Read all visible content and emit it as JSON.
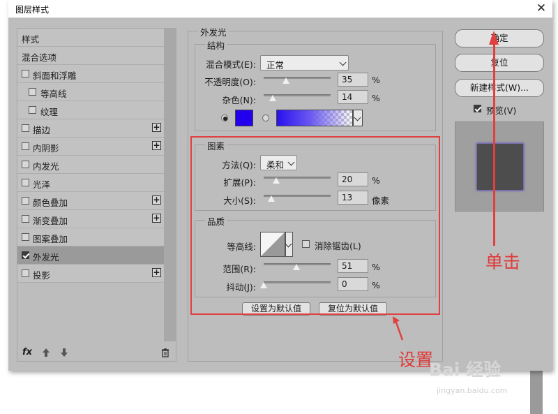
{
  "dialog": {
    "title": "图层样式",
    "close_glyph": "✕"
  },
  "styles_list": {
    "items": [
      {
        "label": "样式",
        "checkbox": false,
        "checked": false,
        "plus": false
      },
      {
        "label": "混合选项",
        "checkbox": false,
        "checked": false,
        "plus": false
      },
      {
        "label": "斜面和浮雕",
        "checkbox": true,
        "checked": false,
        "plus": false
      },
      {
        "label": "等高线",
        "checkbox": true,
        "checked": false,
        "plus": false,
        "indent": true
      },
      {
        "label": "纹理",
        "checkbox": true,
        "checked": false,
        "plus": false,
        "indent": true
      },
      {
        "label": "描边",
        "checkbox": true,
        "checked": false,
        "plus": true
      },
      {
        "label": "内阴影",
        "checkbox": true,
        "checked": false,
        "plus": true
      },
      {
        "label": "内发光",
        "checkbox": true,
        "checked": false,
        "plus": false
      },
      {
        "label": "光泽",
        "checkbox": true,
        "checked": false,
        "plus": false
      },
      {
        "label": "颜色叠加",
        "checkbox": true,
        "checked": false,
        "plus": true
      },
      {
        "label": "渐变叠加",
        "checkbox": true,
        "checked": false,
        "plus": true
      },
      {
        "label": "图案叠加",
        "checkbox": true,
        "checked": false,
        "plus": false
      },
      {
        "label": "外发光",
        "checkbox": true,
        "checked": true,
        "plus": false,
        "selected": true
      },
      {
        "label": "投影",
        "checkbox": true,
        "checked": false,
        "plus": true
      }
    ],
    "footer": {
      "fx": "fx",
      "trash_icon": "trash-icon"
    }
  },
  "outer_glow": {
    "section_title": "外发光",
    "structure": {
      "title": "结构",
      "blend_mode_label": "混合模式(E):",
      "blend_mode_value": "正常",
      "opacity_label": "不透明度(O):",
      "opacity_value": "35",
      "opacity_unit": "%",
      "noise_label": "杂色(N):",
      "noise_value": "14",
      "noise_unit": "%",
      "color": "#2200ee"
    },
    "elements": {
      "title": "图素",
      "technique_label": "方法(Q):",
      "technique_value": "柔和",
      "spread_label": "扩展(P):",
      "spread_value": "20",
      "spread_unit": "%",
      "size_label": "大小(S):",
      "size_value": "13",
      "size_unit": "像素"
    },
    "quality": {
      "title": "品质",
      "contour_label": "等高线:",
      "antialias_label": "消除锯齿(L)",
      "antialias_checked": false,
      "range_label": "范围(R):",
      "range_value": "51",
      "range_unit": "%",
      "jitter_label": "抖动(J):",
      "jitter_value": "0",
      "jitter_unit": "%"
    },
    "make_default": "设置为默认值",
    "reset_default": "复位为默认值"
  },
  "buttons": {
    "ok": "确定",
    "reset": "复位",
    "new_style": "新建样式(W)...",
    "preview_label": "预览(V)",
    "preview_checked": true
  },
  "annotations": {
    "click": "单击",
    "settings": "设置",
    "highlight_color": "#e04040"
  },
  "watermark": {
    "brand": "Bai 经验",
    "site": "jingyan.baidu.com"
  }
}
